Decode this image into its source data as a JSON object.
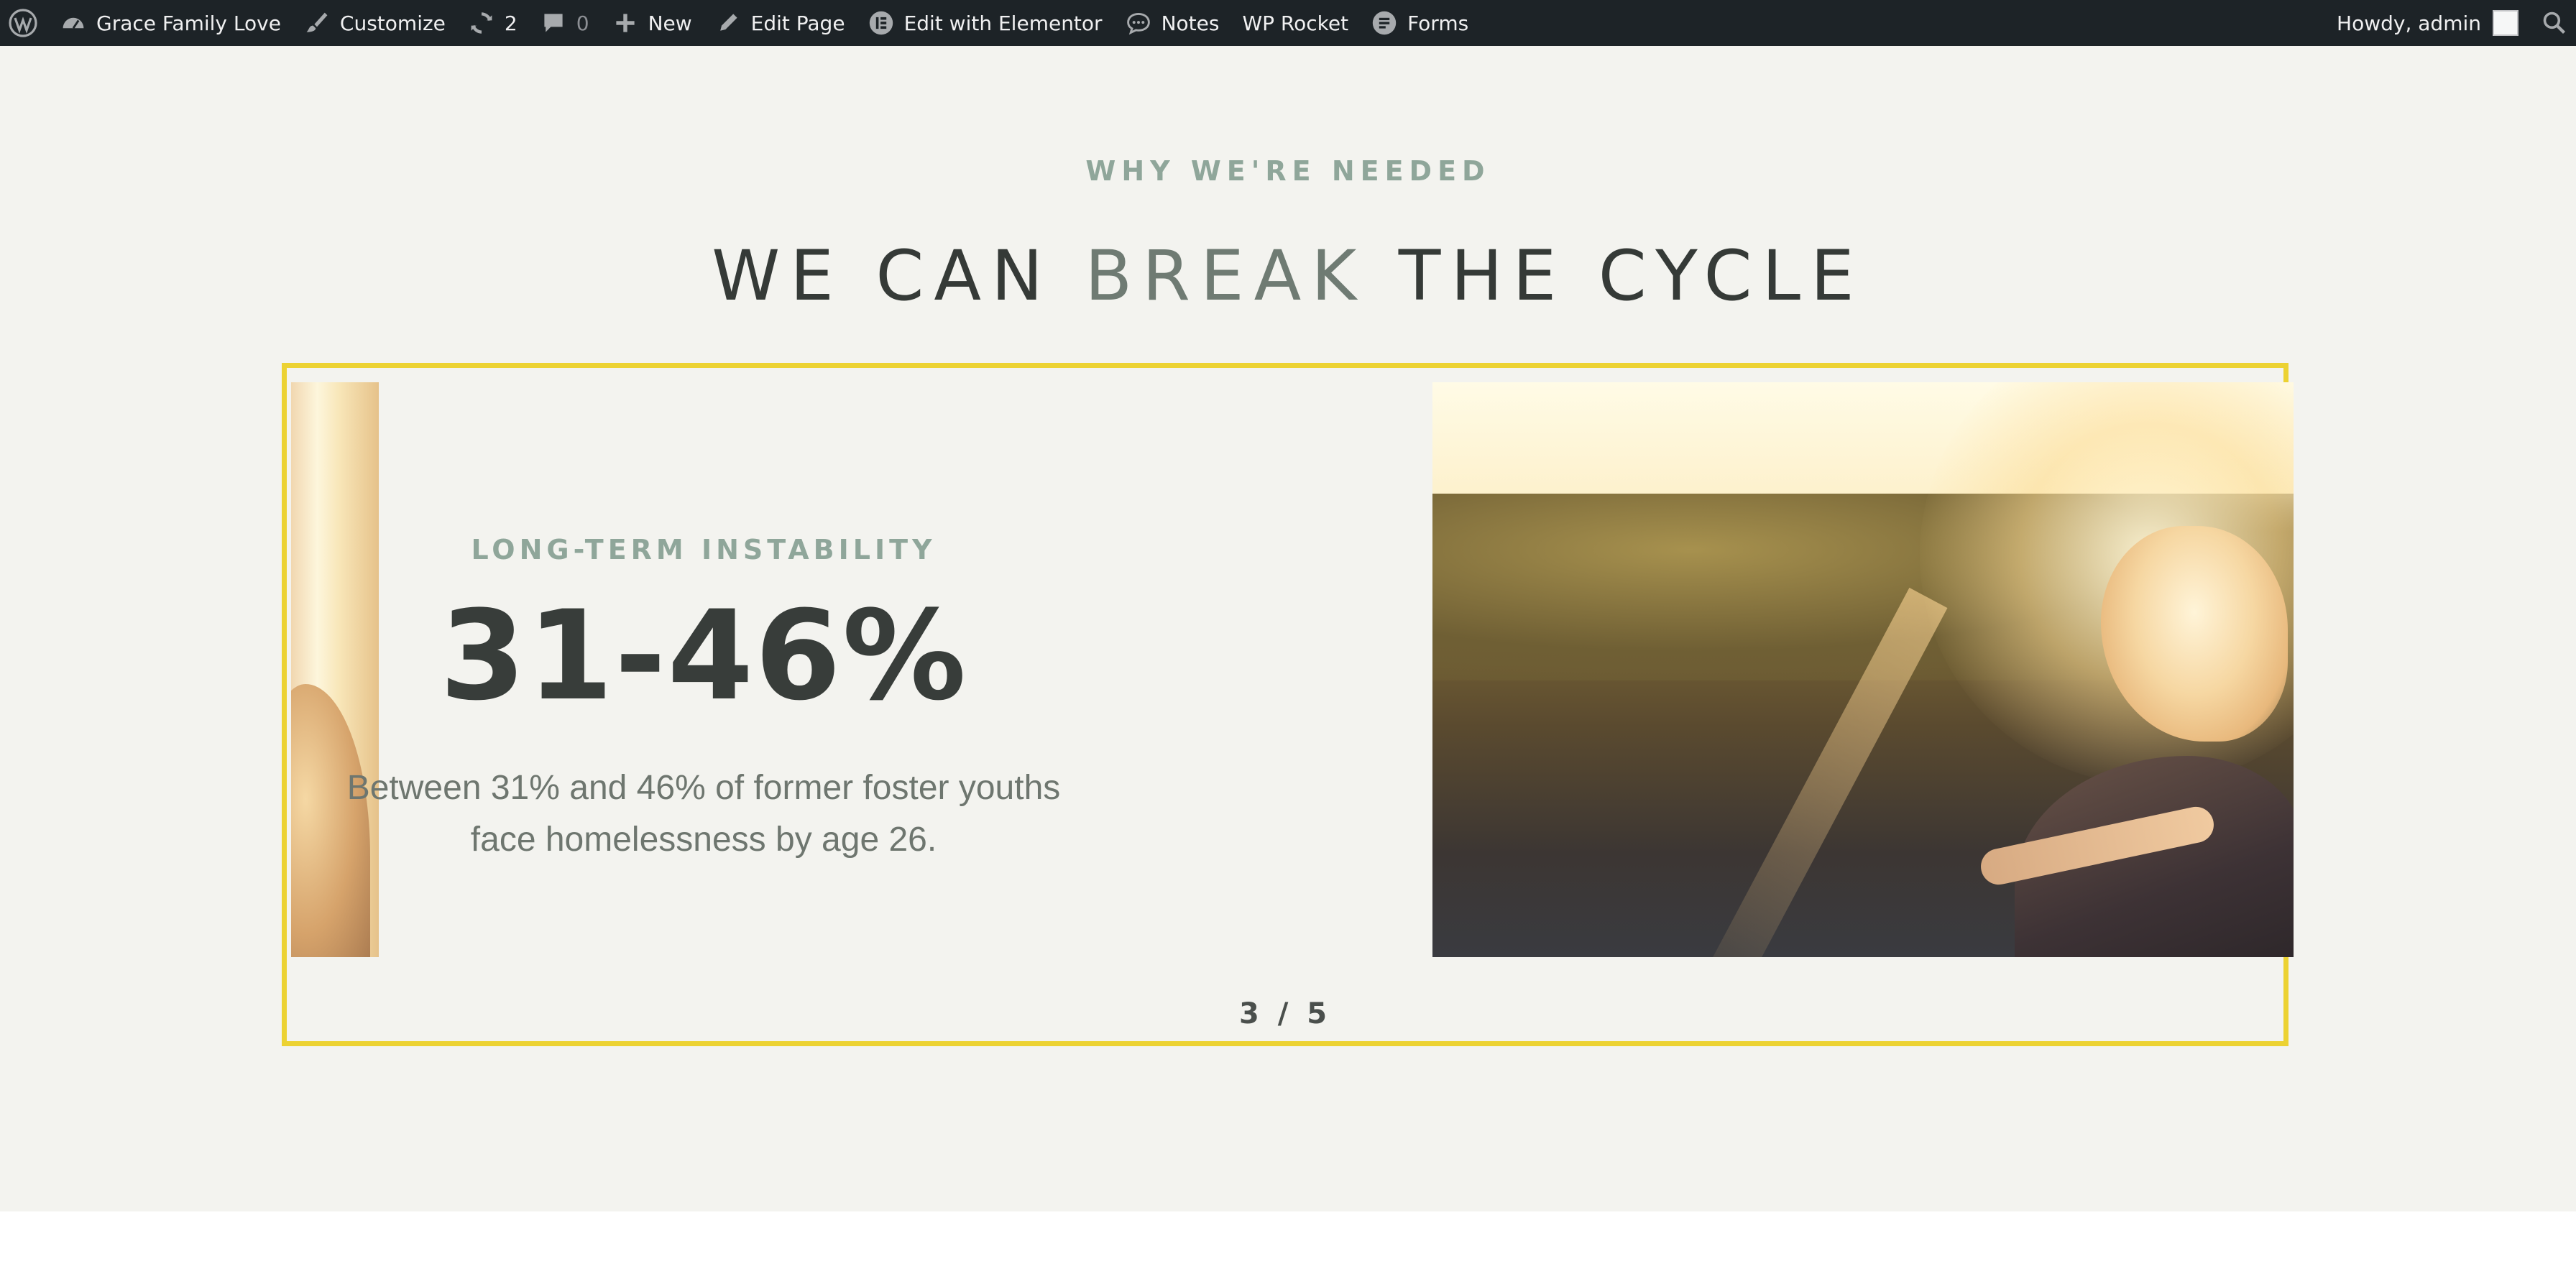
{
  "adminbar": {
    "items": [
      {
        "icon": "wordpress-logo-icon",
        "label": ""
      },
      {
        "icon": "dashboard-icon",
        "label": "Grace Family Love"
      },
      {
        "icon": "paintbrush-icon",
        "label": "Customize"
      },
      {
        "icon": "updates-icon",
        "label": "2"
      },
      {
        "icon": "comment-icon",
        "label": "0"
      },
      {
        "icon": "plus-icon",
        "label": "New"
      },
      {
        "icon": "pencil-icon",
        "label": "Edit Page"
      },
      {
        "icon": "elementor-icon",
        "label": "Edit with Elementor"
      },
      {
        "icon": "speech-bubble-icon",
        "label": "Notes"
      },
      {
        "icon": "",
        "label": "WP Rocket"
      },
      {
        "icon": "forms-icon",
        "label": "Forms"
      }
    ],
    "greeting": "Howdy, admin"
  },
  "section": {
    "eyebrow": "WHY WE'RE NEEDED",
    "headline": {
      "part1": "WE CAN ",
      "accent": "BREAK",
      "part2": " THE CYCLE"
    },
    "accent_color": "#6f7b73",
    "slider": {
      "border_color": "#ecd232",
      "slide": {
        "label": "LONG-TERM INSTABILITY",
        "stat": "31-46%",
        "description": "Between 31% and 46% of former foster youths face homelessness by age 26."
      },
      "counter": "3 / 5"
    }
  }
}
